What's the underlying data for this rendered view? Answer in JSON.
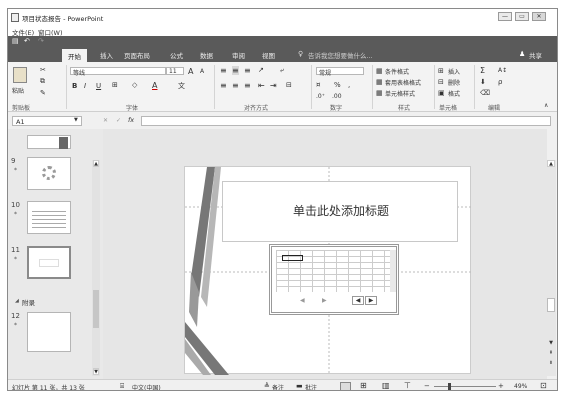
{
  "window": {
    "title": "项目状态报告 - PowerPoint",
    "min_label": "—",
    "restore_label": "▭",
    "close_label": "✕"
  },
  "menubar": {
    "file": "文件(E)",
    "window": "窗口(W)"
  },
  "qat": {
    "save": "▤",
    "undo": "↶",
    "redo": "↷"
  },
  "tabs": [
    "开始",
    "插入",
    "页面布局",
    "公式",
    "数据",
    "审阅",
    "视图"
  ],
  "tellme": "告诉我您想要做什么...",
  "share": "共享",
  "ribbon": {
    "clipboard": {
      "paste": "粘贴",
      "label": "剪贴板"
    },
    "font": {
      "name": "等线",
      "size": "11",
      "grow": "A",
      "shrink": "A",
      "bold": "B",
      "italic": "I",
      "underline": "U",
      "label": "字体"
    },
    "alignment": {
      "label": "对齐方式"
    },
    "number": {
      "format": "常规",
      "percent": "%",
      "comma": ",",
      "label": "数字"
    },
    "styles": {
      "conditional": "条件格式",
      "table": "套用表格格式",
      "cell": "单元格样式",
      "label": "样式"
    },
    "cells": {
      "insert": "插入",
      "delete": "删除",
      "format": "格式",
      "label": "单元格"
    },
    "editing": {
      "sum": "Σ",
      "sort": "A↕",
      "find": "ρ",
      "label": "编辑"
    }
  },
  "formula_bar": {
    "namebox": "A1",
    "cancel": "✕",
    "enter": "✓",
    "fx": "fx",
    "value": ""
  },
  "slides": {
    "n9": "9",
    "n10": "10",
    "n11": "11",
    "section": "附录",
    "n12": "12"
  },
  "slide": {
    "title_placeholder": "单击此处添加标题"
  },
  "status": {
    "info": "幻灯片 第 11 张，共 13 张",
    "lang": "中文(中国)",
    "notes": "备注",
    "comments": "批注",
    "zoom": "49%",
    "zoom_level": 0.49
  },
  "colors": {
    "ribbon_dark": "#5a5a5a",
    "ribbon_light": "#f3f3f3",
    "slide_bg": "#ffffff"
  }
}
